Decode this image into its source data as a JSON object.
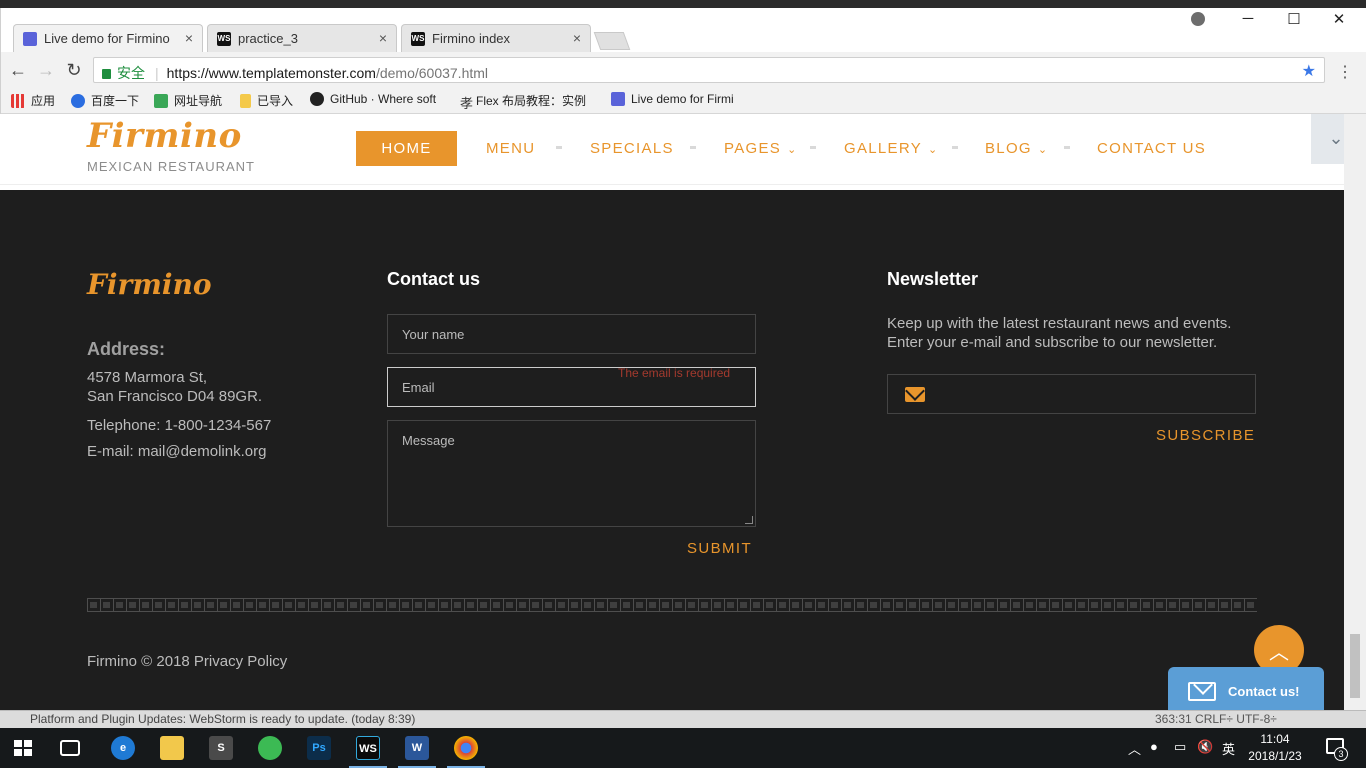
{
  "browser": {
    "tabs": [
      {
        "label": "Live demo for Firmino",
        "icon": "templatemonster-icon",
        "active": true
      },
      {
        "label": "practice_3",
        "icon": "webstorm-icon",
        "active": false
      },
      {
        "label": "Firmino index",
        "icon": "webstorm-icon",
        "active": false
      }
    ],
    "close_glyph": "×",
    "secure_label": "安全",
    "url_host": "https://www.templatemonster.com",
    "url_path": "/demo/60037.html",
    "bookmarks": [
      {
        "label": "应用",
        "icon": "apps-grid-icon"
      },
      {
        "label": "百度一下",
        "icon": "baidu-paw-icon"
      },
      {
        "label": "网址导航",
        "icon": "hao123-icon"
      },
      {
        "label": "已导入",
        "icon": "folder-icon"
      },
      {
        "label": "GitHub · Where soft",
        "icon": "github-icon"
      },
      {
        "label": "Flex 布局教程：实例",
        "icon": "ruanyf-icon"
      },
      {
        "label": "Live demo for Firmi",
        "icon": "templatemonster-icon"
      }
    ]
  },
  "site": {
    "logo": "Firmino",
    "logo_sub": "MEXICAN RESTAURANT",
    "nav": [
      {
        "label": "HOME",
        "active": true,
        "dropdown": false
      },
      {
        "label": "MENU",
        "active": false,
        "dropdown": false
      },
      {
        "label": "SPECIALS",
        "active": false,
        "dropdown": false
      },
      {
        "label": "PAGES",
        "active": false,
        "dropdown": true
      },
      {
        "label": "GALLERY",
        "active": false,
        "dropdown": true
      },
      {
        "label": "BLOG",
        "active": false,
        "dropdown": true
      },
      {
        "label": "CONTACT US",
        "active": false,
        "dropdown": false
      }
    ],
    "toggle_glyph": "⌄"
  },
  "footer": {
    "logo": "Firmino",
    "address_title": "Address:",
    "address_line1": "4578 Marmora St,",
    "address_line2": "San Francisco D04 89GR.",
    "telephone": "Telephone: 1-800-1234-567",
    "email": "E-mail: mail@demolink.org",
    "contact_title": "Contact us",
    "name_placeholder": "Your name",
    "email_placeholder": "Email",
    "email_error": "The email is required",
    "message_placeholder": "Message",
    "submit_label": "SUBMIT",
    "newsletter_title": "Newsletter",
    "newsletter_text": "Keep up with the latest restaurant news and events. Enter your e-mail and subscribe to our newsletter.",
    "subscribe_label": "SUBSCRIBE",
    "copyright": "Firmino © 2018 Privacy Policy",
    "to_top_glyph": "︿",
    "contact_widget_label": "Contact us!"
  },
  "ide_status": {
    "message": "Platform and Plugin Updates: WebStorm is ready to update. (today 8:39)",
    "right": "363:31   CRLF÷   UTF-8÷"
  },
  "taskbar": {
    "time": "11:04",
    "date": "2018/1/23",
    "ime": "英",
    "notifications": "3"
  },
  "colors": {
    "accent": "#e8952c",
    "footer_bg": "#1e1e1e",
    "error": "#a33a2e",
    "contact_widget": "#5b9ed6"
  }
}
